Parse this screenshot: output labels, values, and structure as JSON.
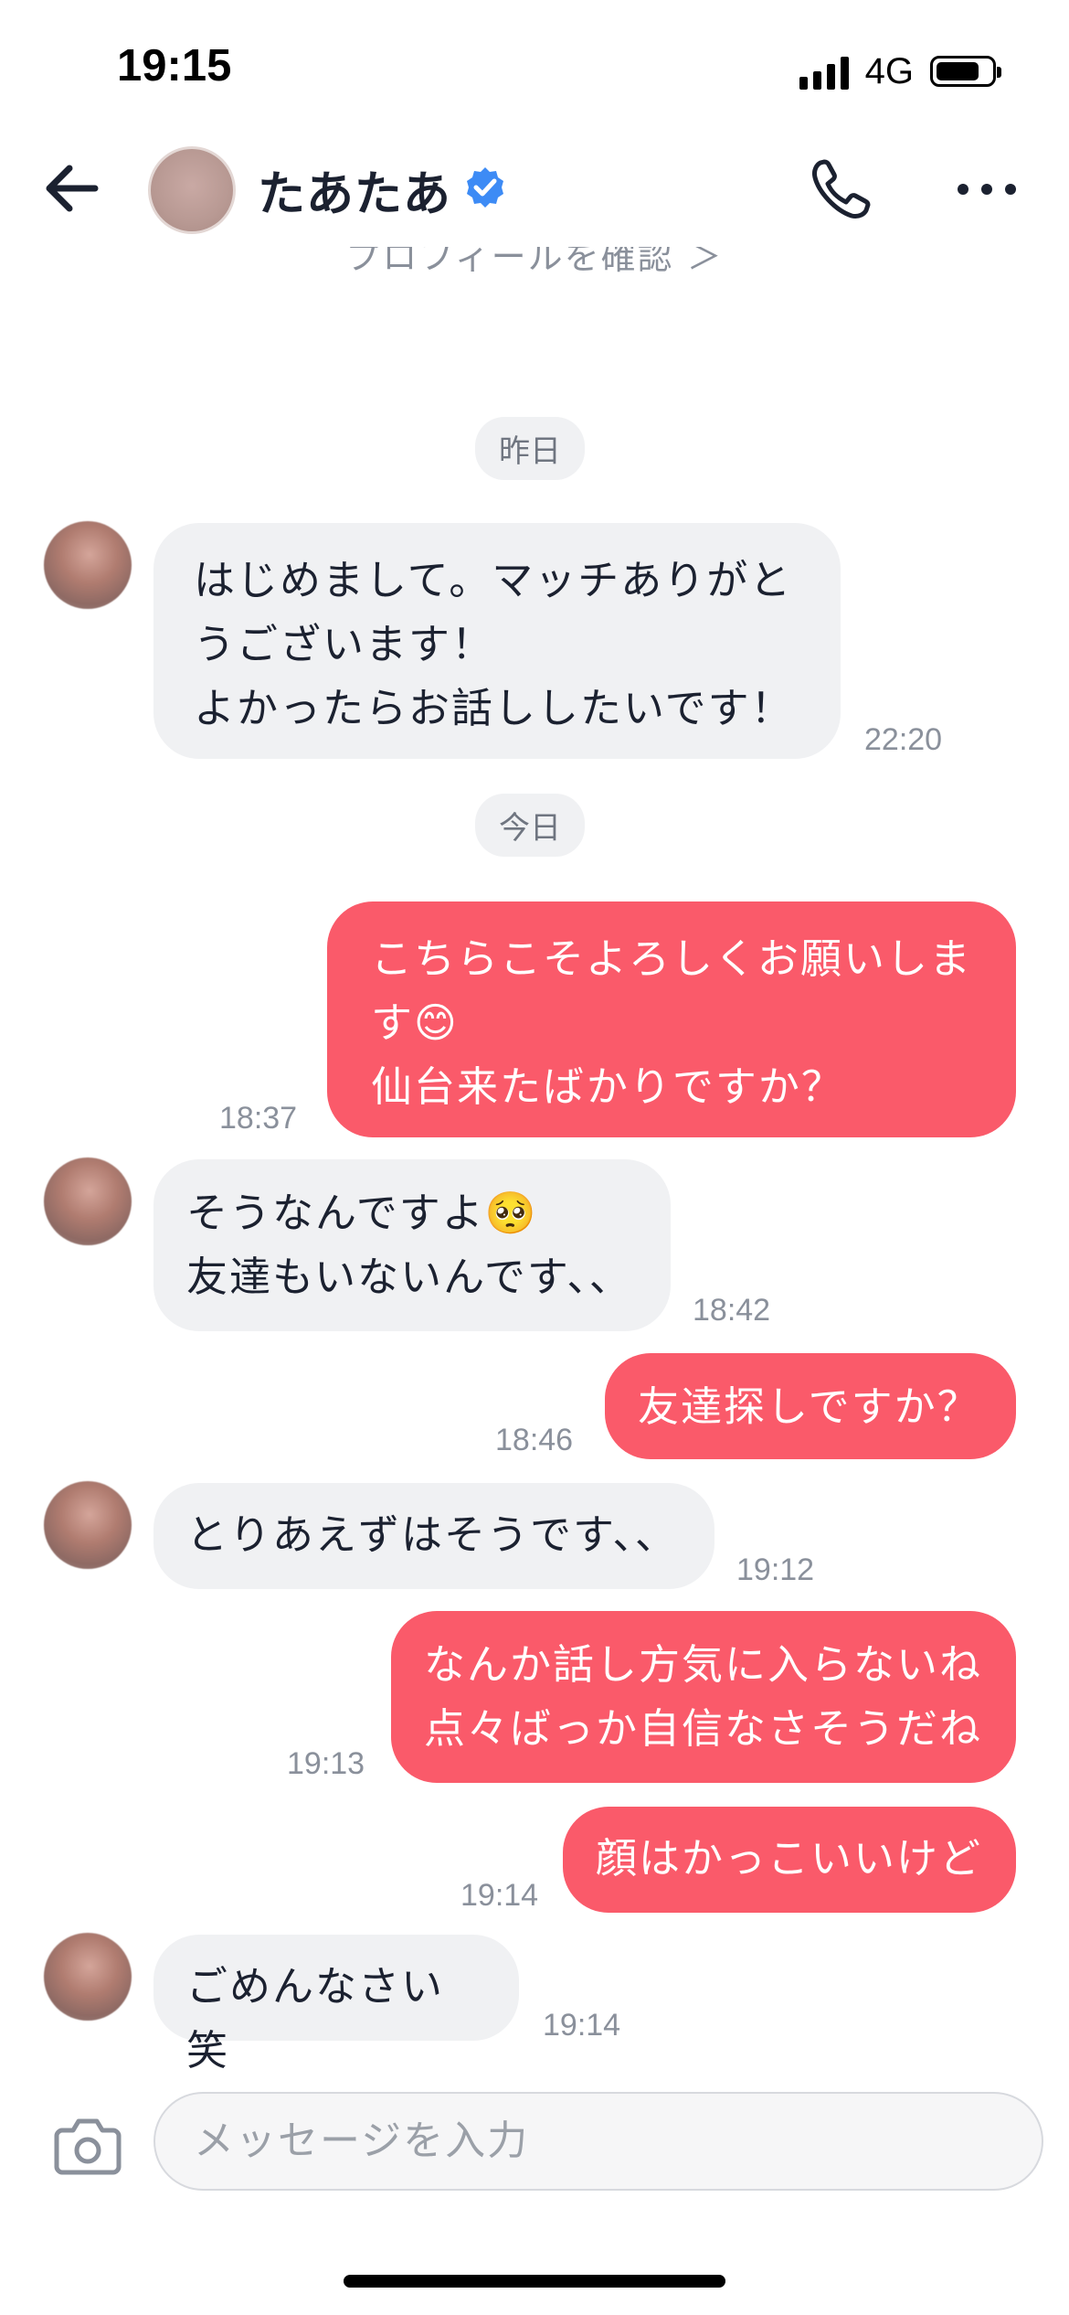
{
  "status_bar": {
    "time": "19:15",
    "network": "4G",
    "battery_level": 0.8
  },
  "header": {
    "contact_name": "たあたあ",
    "profile_link": "プロフィールを確認 ＞",
    "verified_color": "#3d8bf5"
  },
  "date_chips": {
    "yesterday": "昨日",
    "today": "今日"
  },
  "messages": [
    {
      "side": "in",
      "text": "はじめまして。マッチありがと\nうございます！\nよかったらお話ししたいです！",
      "time": "22:20"
    },
    {
      "side": "out",
      "text": "こちらこそよろしくお願いしま\nす😊\n仙台来たばかりですか？",
      "time": "18:37"
    },
    {
      "side": "in",
      "text": "そうなんですよ🥺\n友達もいないんです、、",
      "time": "18:42"
    },
    {
      "side": "out",
      "text": "友達探しですか？",
      "time": "18:46"
    },
    {
      "side": "in",
      "text": "とりあえずはそうです、、",
      "time": "19:12"
    },
    {
      "side": "out",
      "text": "なんか話し方気に入らないね\n点々ばっか自信なさそうだね",
      "time": "19:13"
    },
    {
      "side": "out",
      "text": "顔はかっこいいけど",
      "time": "19:14"
    },
    {
      "side": "in",
      "text": "ごめんなさい笑",
      "time": "19:14"
    }
  ],
  "input": {
    "placeholder": "メッセージを入力"
  },
  "colors": {
    "outgoing_bubble": "#fa5a6a",
    "incoming_bubble": "#f0f1f3",
    "primary_text": "#1b2130"
  }
}
